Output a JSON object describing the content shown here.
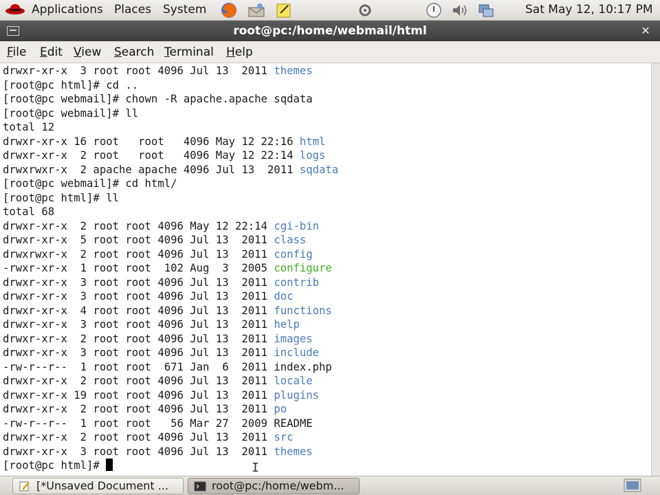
{
  "top_panel": {
    "menus": [
      "Applications",
      "Places",
      "System"
    ],
    "clock": "Sat May 12, 10:17 PM"
  },
  "window": {
    "title": "root@pc:/home/webmail/html"
  },
  "menubar": {
    "items": [
      {
        "first": "F",
        "rest": "ile"
      },
      {
        "first": "E",
        "rest": "dit"
      },
      {
        "first": "V",
        "rest": "iew"
      },
      {
        "first": "S",
        "rest": "earch"
      },
      {
        "first": "T",
        "rest": "erminal"
      },
      {
        "first": "H",
        "rest": "elp"
      }
    ]
  },
  "terminal": {
    "lines": [
      {
        "text": "drwxr-xr-x  3 root root 4096 Jul 13  2011 ",
        "name": "themes",
        "color": "blue"
      },
      {
        "text": "[root@pc html]# cd ..",
        "name": "",
        "color": ""
      },
      {
        "text": "[root@pc webmail]# chown -R apache.apache sqdata",
        "name": "",
        "color": ""
      },
      {
        "text": "[root@pc webmail]# ll",
        "name": "",
        "color": ""
      },
      {
        "text": "total 12",
        "name": "",
        "color": ""
      },
      {
        "text": "drwxr-xr-x 16 root   root   4096 May 12 22:16 ",
        "name": "html",
        "color": "blue"
      },
      {
        "text": "drwxr-xr-x  2 root   root   4096 May 12 22:14 ",
        "name": "logs",
        "color": "blue"
      },
      {
        "text": "drwxrwxr-x  2 apache apache 4096 Jul 13  2011 ",
        "name": "sqdata",
        "color": "blue"
      },
      {
        "text": "[root@pc webmail]# cd html/",
        "name": "",
        "color": ""
      },
      {
        "text": "[root@pc html]# ll",
        "name": "",
        "color": ""
      },
      {
        "text": "total 68",
        "name": "",
        "color": ""
      },
      {
        "text": "drwxr-xr-x  2 root root 4096 May 12 22:14 ",
        "name": "cgi-bin",
        "color": "blue"
      },
      {
        "text": "drwxr-xr-x  5 root root 4096 Jul 13  2011 ",
        "name": "class",
        "color": "blue"
      },
      {
        "text": "drwxrwxr-x  2 root root 4096 Jul 13  2011 ",
        "name": "config",
        "color": "blue"
      },
      {
        "text": "-rwxr-xr-x  1 root root  102 Aug  3  2005 ",
        "name": "configure",
        "color": "green"
      },
      {
        "text": "drwxr-xr-x  3 root root 4096 Jul 13  2011 ",
        "name": "contrib",
        "color": "blue"
      },
      {
        "text": "drwxr-xr-x  3 root root 4096 Jul 13  2011 ",
        "name": "doc",
        "color": "blue"
      },
      {
        "text": "drwxr-xr-x  4 root root 4096 Jul 13  2011 ",
        "name": "functions",
        "color": "blue"
      },
      {
        "text": "drwxr-xr-x  3 root root 4096 Jul 13  2011 ",
        "name": "help",
        "color": "blue"
      },
      {
        "text": "drwxr-xr-x  2 root root 4096 Jul 13  2011 ",
        "name": "images",
        "color": "blue"
      },
      {
        "text": "drwxr-xr-x  3 root root 4096 Jul 13  2011 ",
        "name": "include",
        "color": "blue"
      },
      {
        "text": "-rw-r--r--  1 root root  671 Jan  6  2011 ",
        "name": "index.php",
        "color": ""
      },
      {
        "text": "drwxr-xr-x  2 root root 4096 Jul 13  2011 ",
        "name": "locale",
        "color": "blue"
      },
      {
        "text": "drwxr-xr-x 19 root root 4096 Jul 13  2011 ",
        "name": "plugins",
        "color": "blue"
      },
      {
        "text": "drwxr-xr-x  2 root root 4096 Jul 13  2011 ",
        "name": "po",
        "color": "blue"
      },
      {
        "text": "-rw-r--r--  1 root root   56 Mar 27  2009 ",
        "name": "README",
        "color": ""
      },
      {
        "text": "drwxr-xr-x  2 root root 4096 Jul 13  2011 ",
        "name": "src",
        "color": "blue"
      },
      {
        "text": "drwxr-xr-x  3 root root 4096 Jul 13  2011 ",
        "name": "themes",
        "color": "blue"
      }
    ],
    "prompt": "[root@pc html]# "
  },
  "taskbar": {
    "tasks": [
      "[*Unsaved Document ...",
      "root@pc:/home/webm..."
    ]
  },
  "colors": {
    "dir": "#4a7ab8",
    "exec": "#3db01e",
    "titlebar": "#4a4a4a"
  },
  "icons": [
    "redhat-icon",
    "firefox-icon",
    "mail-icon",
    "notes-icon",
    "network-icon",
    "update-icon",
    "volume-icon",
    "display-icon",
    "terminal-icon",
    "text-editor-icon",
    "show-desktop-icon"
  ]
}
